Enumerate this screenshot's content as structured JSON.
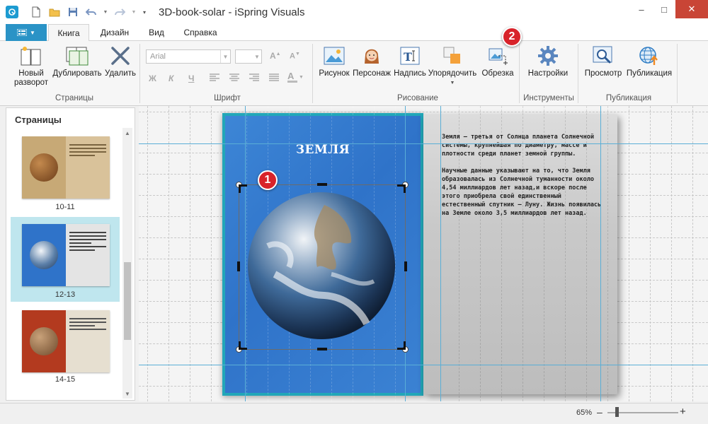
{
  "window": {
    "title": "3D-book-solar - iSpring Visuals",
    "minimize": "–",
    "maximize": "□",
    "close": "✕"
  },
  "file_button": {
    "icon": "menu-icon"
  },
  "tabs": [
    {
      "label": "Книга",
      "active": true
    },
    {
      "label": "Дизайн"
    },
    {
      "label": "Вид"
    },
    {
      "label": "Справка"
    }
  ],
  "ribbon": {
    "pages_group": {
      "label": "Страницы",
      "new_spread": "Новый\nразворот",
      "duplicate": "Дублировать",
      "delete": "Удалить"
    },
    "font_group": {
      "label": "Шрифт",
      "font_name": "Arial",
      "bold": "Ж",
      "italic": "К",
      "underline": "Ч"
    },
    "draw_group": {
      "label": "Рисование",
      "picture": "Рисунок",
      "character": "Персонаж",
      "caption": "Надпись",
      "arrange": "Упорядочить",
      "crop": "Обрезка"
    },
    "tools_group": {
      "label": "Инструменты",
      "settings": "Настройки"
    },
    "publish_group": {
      "label": "Публикация",
      "preview": "Просмотр",
      "publish": "Публикация"
    }
  },
  "pages_panel": {
    "header": "Страницы",
    "items": [
      {
        "label": "10-11",
        "selected": false,
        "planet_color": "#8a5a2b"
      },
      {
        "label": "12-13",
        "selected": true,
        "planet_color": "#2f6fc4"
      },
      {
        "label": "14-15",
        "selected": false,
        "planet_color": "#a33a22"
      }
    ]
  },
  "canvas": {
    "page_title": "ЗЕМЛЯ",
    "paragraph1": "Земля — третья от Солнца планета Солнечной системы, крупнейшая по диаметру, массе и плотности среди планет земной группы.",
    "paragraph2": "Научные данные указывают на то, что Земля образовалась из Солнечной туманности около 4,54 миллиардов лет назад,и вскоре после этого приобрела свой единственный естественный спутник — Луну. Жизнь появилась на Земле около 3,5 миллиардов лет назад.",
    "badge1": "1",
    "badge2": "2"
  },
  "status": {
    "zoom": "65%",
    "zoom_minus": "–",
    "zoom_plus": "+",
    "zoom_level_percent": 65
  },
  "colors": {
    "accent": "#2a93c6",
    "selection": "#bfe6ee",
    "badge": "#d8232a",
    "page_blue": "#2f73c9"
  }
}
